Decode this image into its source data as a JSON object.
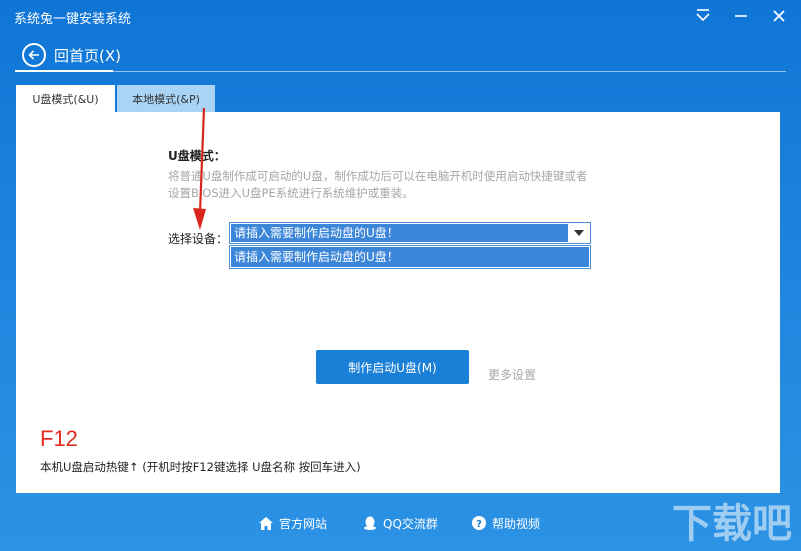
{
  "window": {
    "title": "系统兔一键安装系统"
  },
  "header": {
    "back_label": "回首页(X)"
  },
  "tabs": [
    {
      "label": "U盘模式(&U)",
      "active": true
    },
    {
      "label": "本地模式(&P)",
      "active": false
    }
  ],
  "usb_mode": {
    "heading": "U盘模式：",
    "description": "将普通U盘制作成可启动的U盘，制作成功后可以在电脑开机时使用启动快捷键或者设置BIOS进入U盘PE系统进行系统维护或重装。",
    "device_label": "选择设备：",
    "device_selected": "请插入需要制作启动盘的U盘！",
    "device_options": [
      "请插入需要制作启动盘的U盘！"
    ],
    "make_button": "制作启动U盘(M)",
    "more_settings": "更多设置"
  },
  "hotkey": {
    "key": "F12",
    "hint": "本机U盘启动热键↑ (开机时按F12键选择 U盘名称 按回车进入)"
  },
  "footer": {
    "website": "官方网站",
    "qq_group": "QQ交流群",
    "help_video": "帮助视频"
  },
  "watermark": {
    "text": "下载吧"
  },
  "colors": {
    "accent": "#1a7fd6",
    "select_highlight": "#3b86d8",
    "hotkey_red": "#e02b20",
    "tab_inactive": "#a9d4f5"
  }
}
